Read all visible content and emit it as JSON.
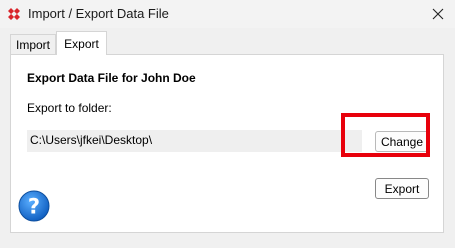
{
  "window": {
    "title": "Import / Export Data File",
    "app_icon": "red-wrench-app-icon",
    "close_icon": "close-icon"
  },
  "tabs": [
    {
      "label": "Import",
      "active": false
    },
    {
      "label": "Export",
      "active": true
    }
  ],
  "export_panel": {
    "heading": "Export Data File for John Doe",
    "folder_label": "Export to folder:",
    "folder_path": "C:\\Users\\jfkei\\Desktop\\",
    "change_button": "Change",
    "export_button": "Export",
    "help_icon": "help-question-icon"
  },
  "colors": {
    "highlight": "#e8000b",
    "help_blue": "#1f7ad6",
    "app_icon_red": "#d9252b"
  }
}
